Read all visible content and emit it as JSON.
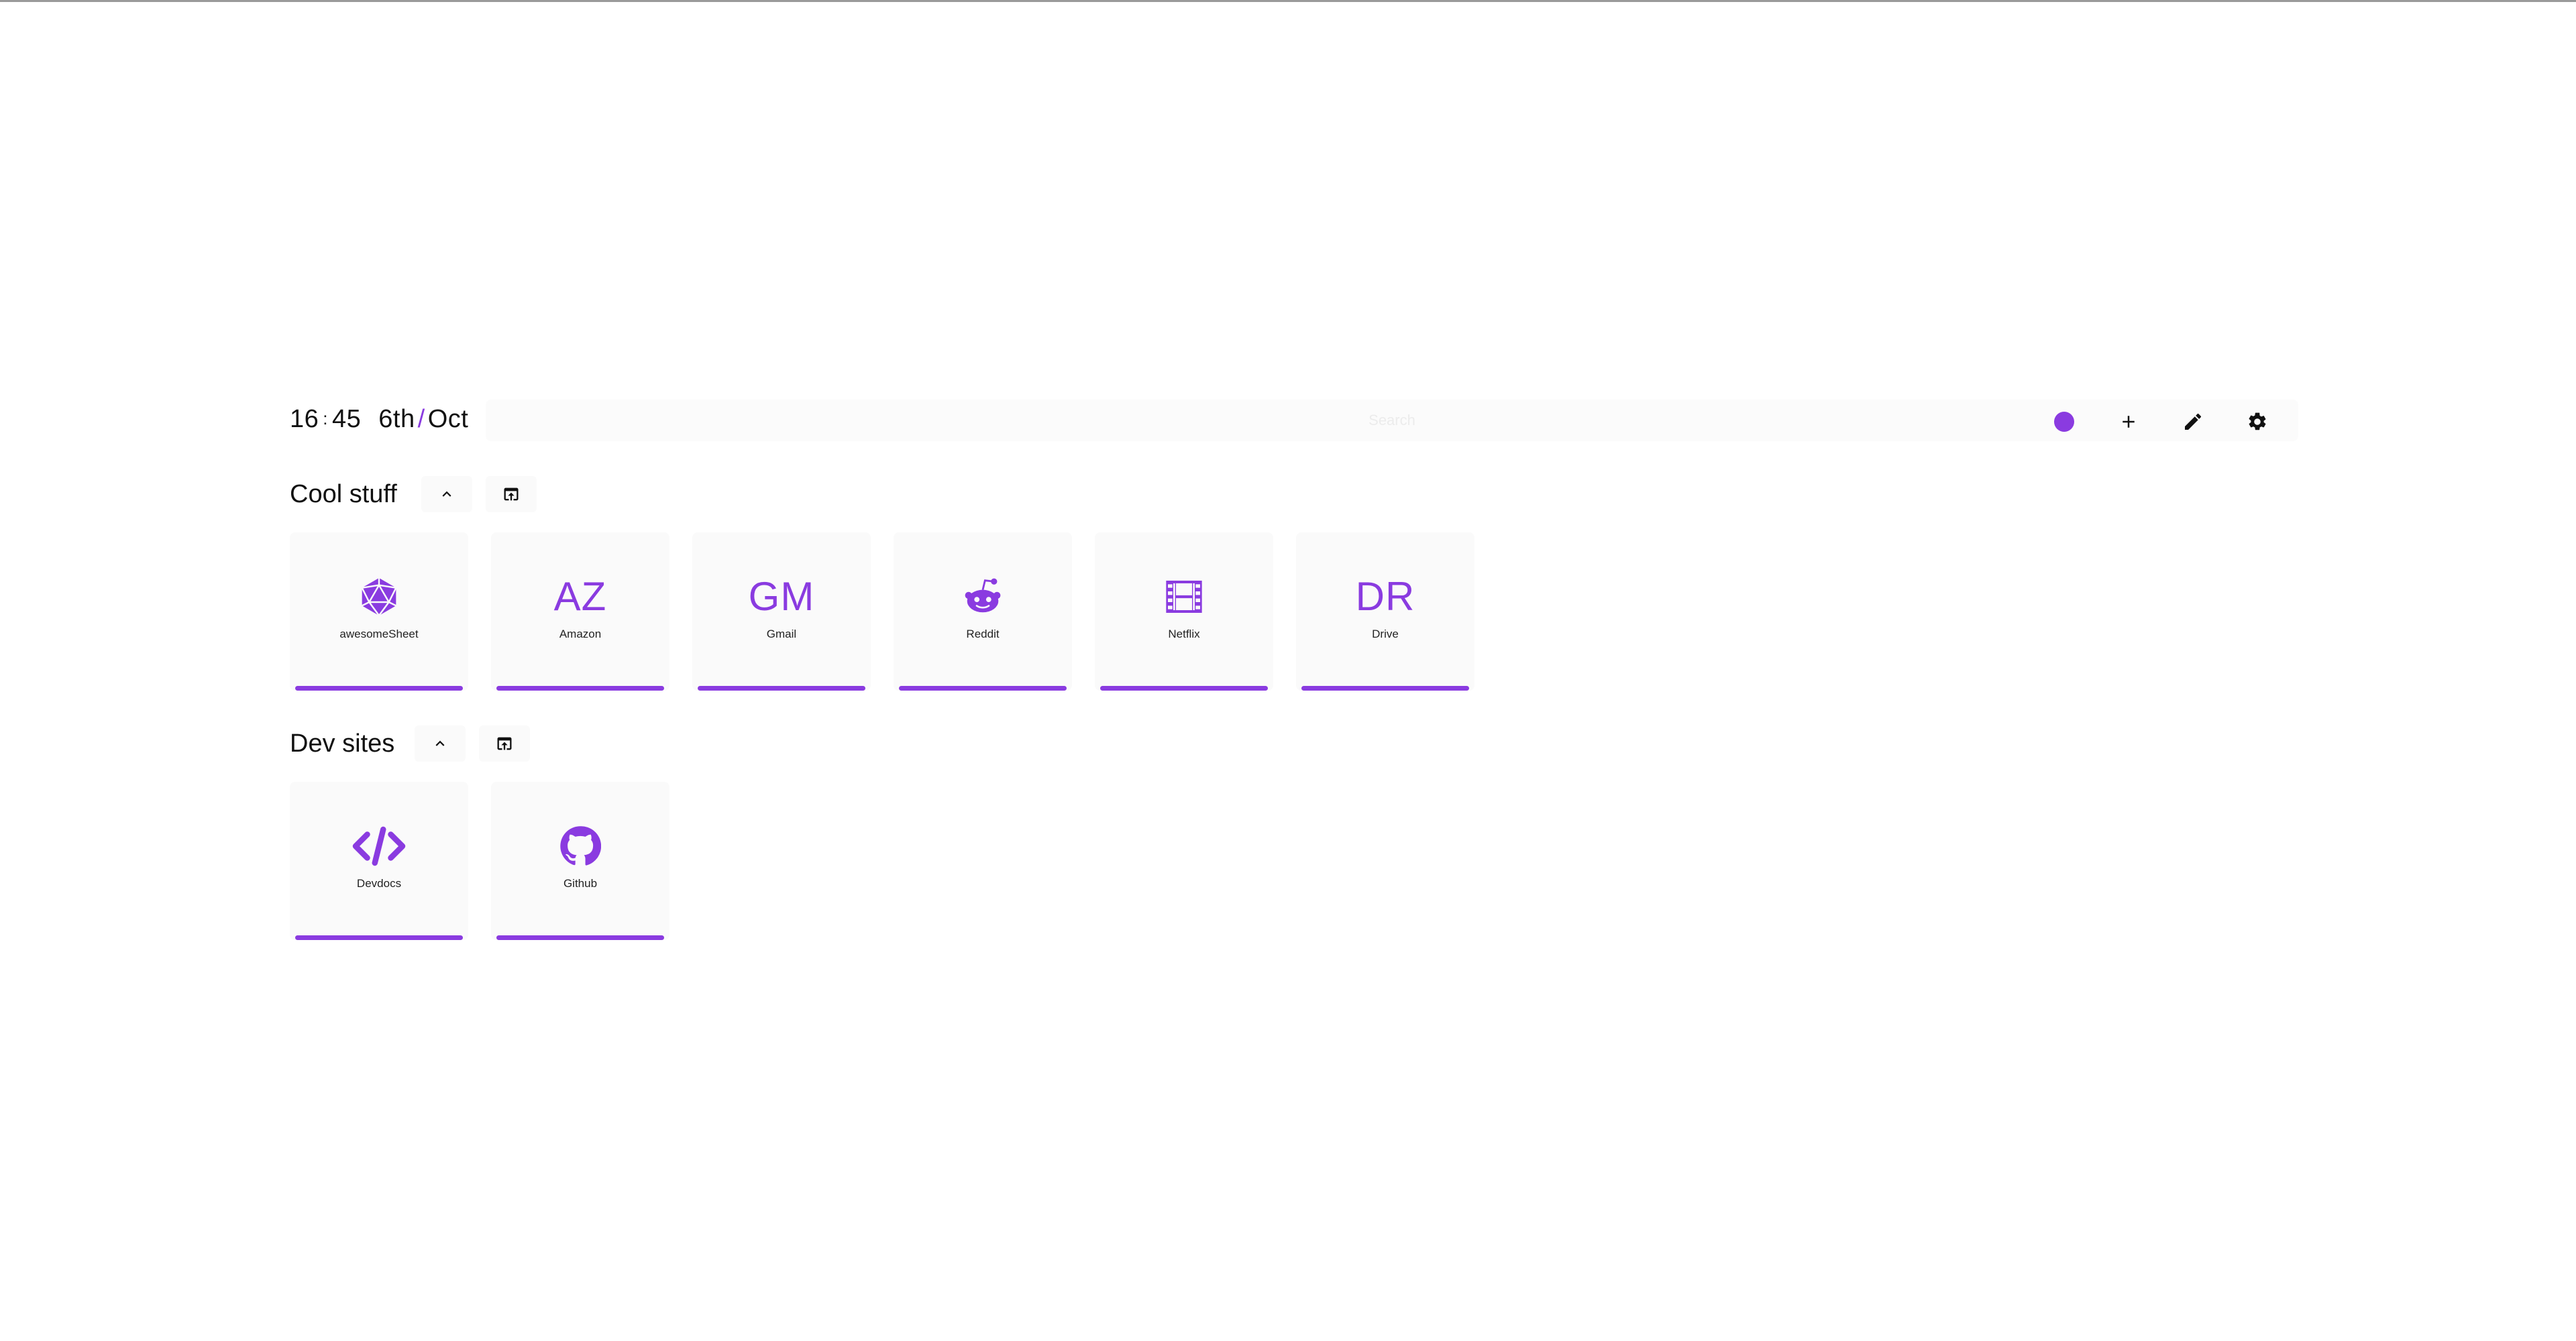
{
  "header": {
    "hours": "16",
    "minutes": "45",
    "day": "6th",
    "month": "Oct",
    "search_placeholder": "Search"
  },
  "toolbar": {
    "theme_color": "#8a3be0",
    "buttons": [
      "theme-dot",
      "add-icon",
      "edit-icon",
      "settings-icon"
    ]
  },
  "groups": [
    {
      "title": "Cool stuff",
      "bookmarks": [
        {
          "label": "awesomeSheet",
          "icon": "d20-dice-icon",
          "letters": ""
        },
        {
          "label": "Amazon",
          "icon": "",
          "letters": "AZ"
        },
        {
          "label": "Gmail",
          "icon": "",
          "letters": "GM"
        },
        {
          "label": "Reddit",
          "icon": "reddit-icon",
          "letters": ""
        },
        {
          "label": "Netflix",
          "icon": "film-icon",
          "letters": ""
        },
        {
          "label": "Drive",
          "icon": "",
          "letters": "DR"
        }
      ]
    },
    {
      "title": "Dev sites",
      "bookmarks": [
        {
          "label": "Devdocs",
          "icon": "code-icon",
          "letters": ""
        },
        {
          "label": "Github",
          "icon": "github-icon",
          "letters": ""
        }
      ]
    }
  ],
  "accent_color": "#8a3be0"
}
